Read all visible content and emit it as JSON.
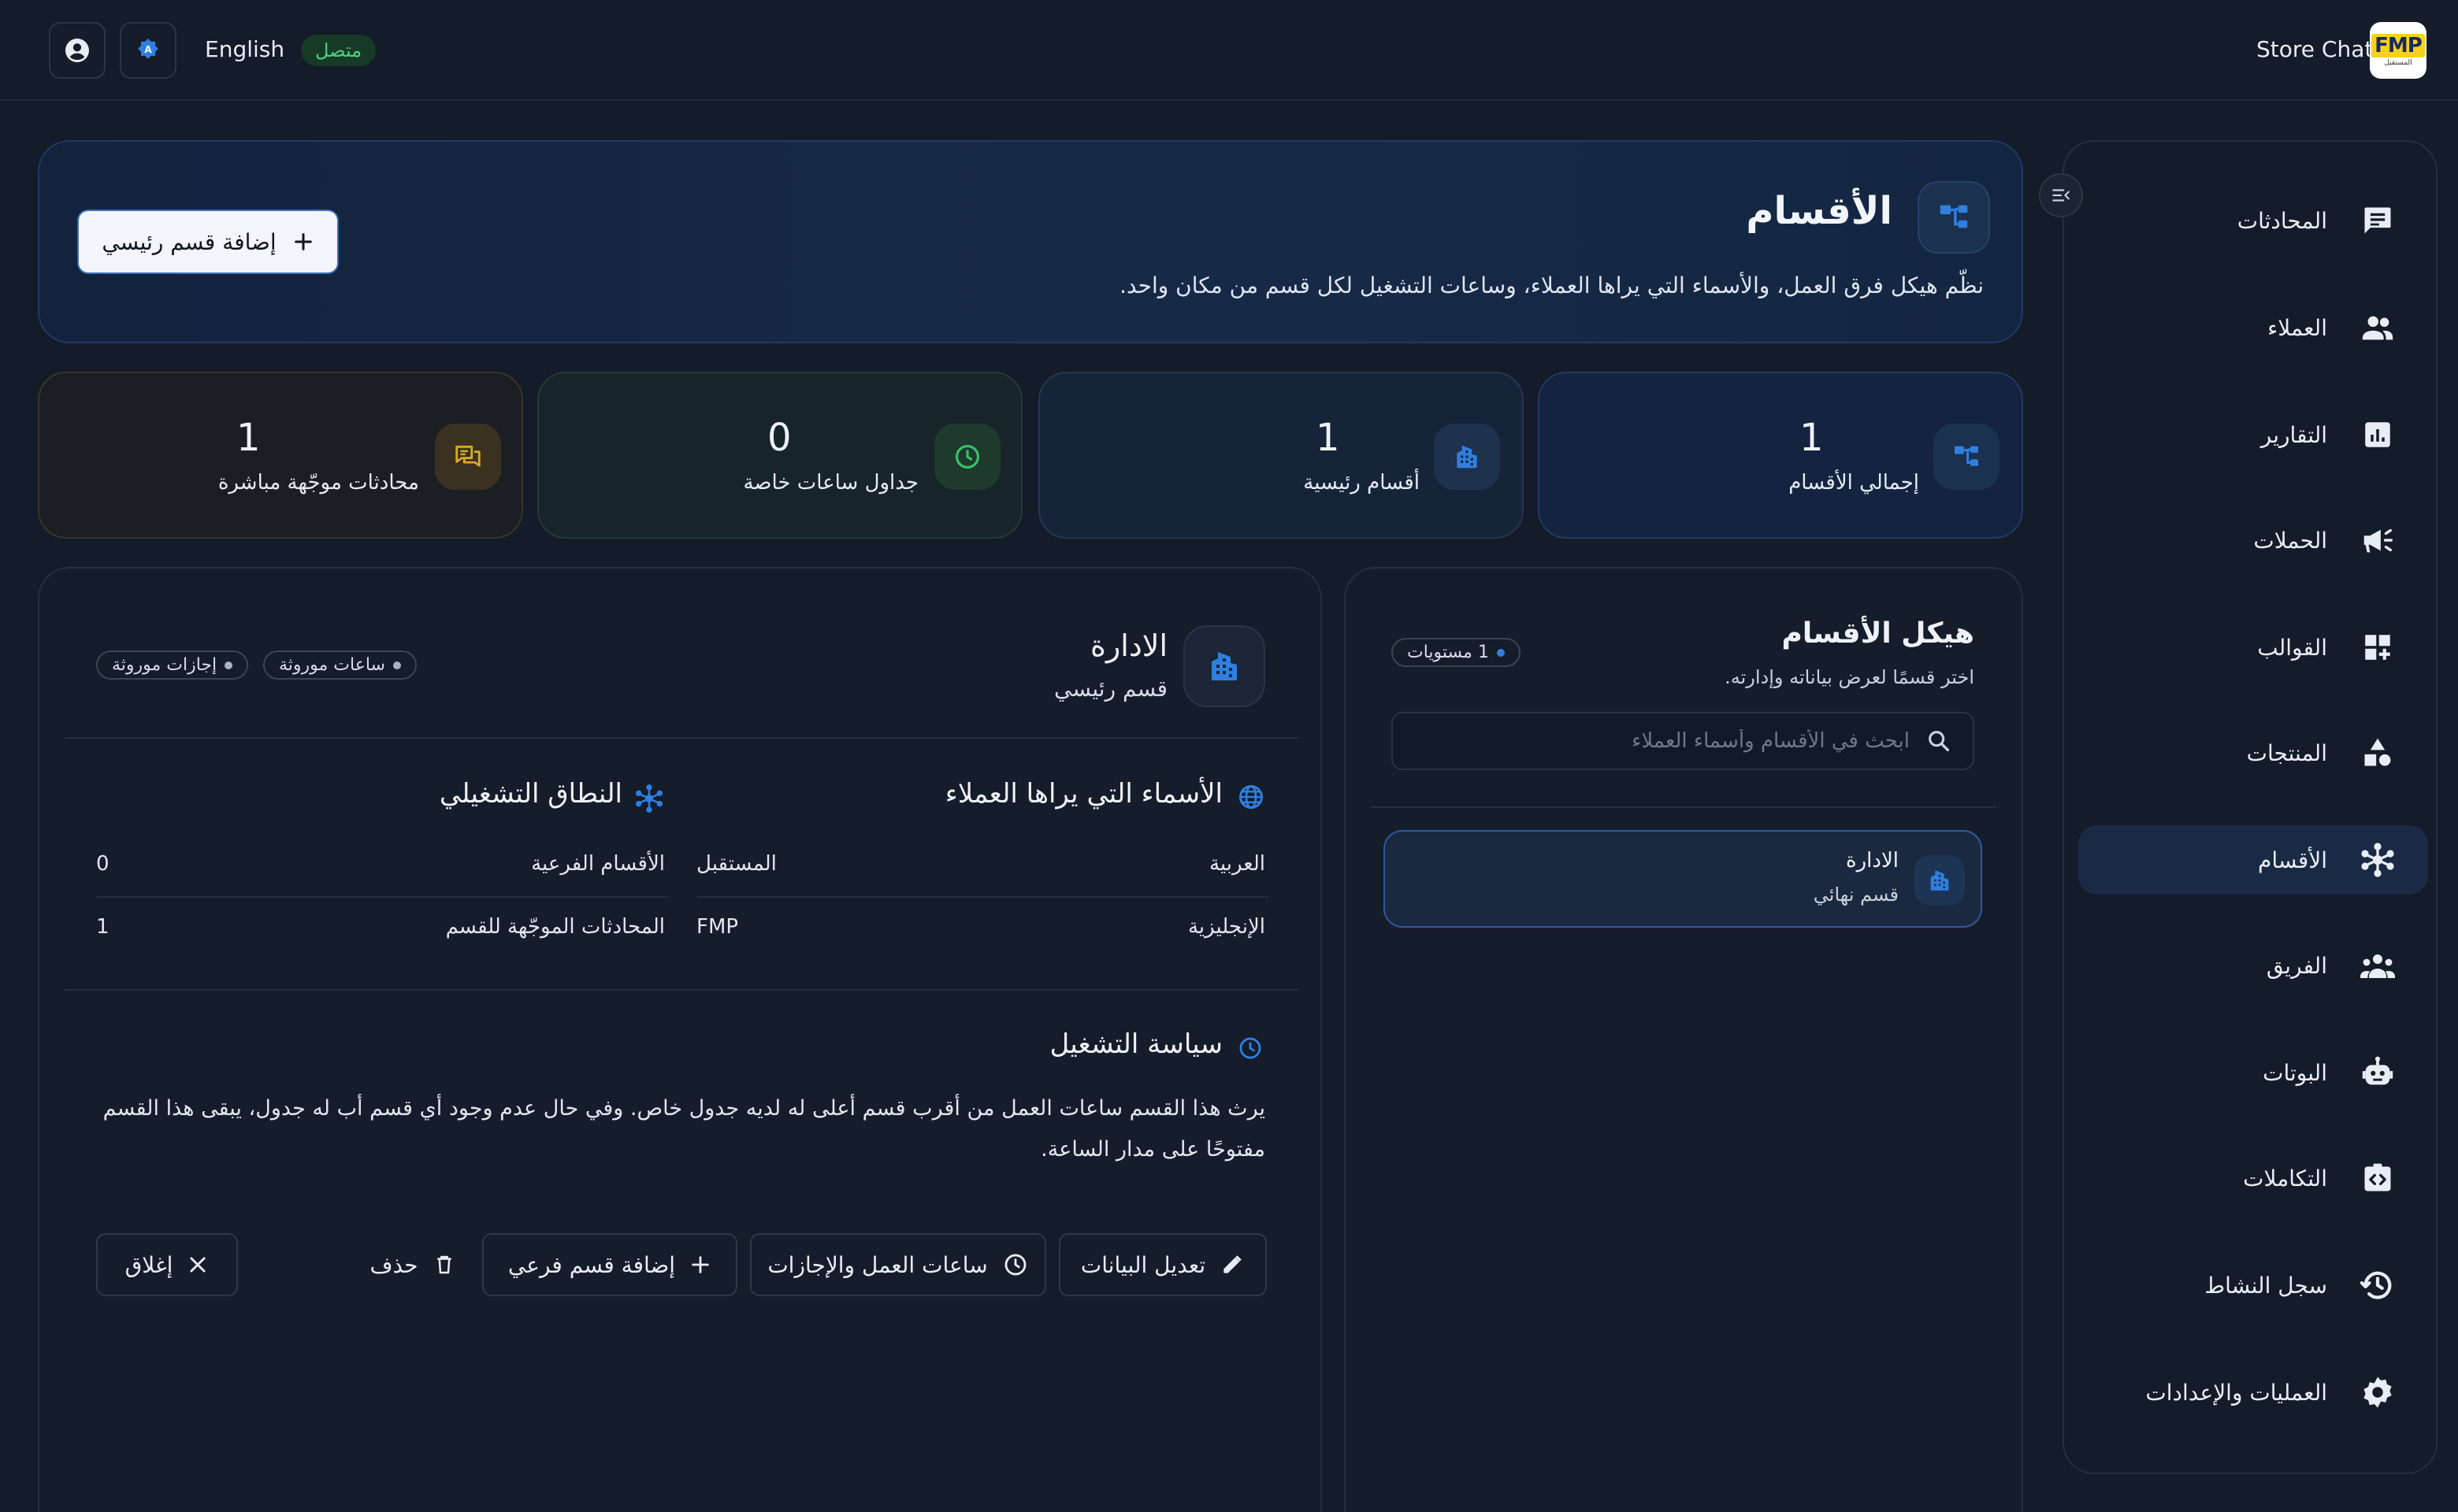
{
  "topbar": {
    "language": "English",
    "status": "متصل",
    "brand_name": "Store Chat",
    "logo_text": "FMP",
    "logo_subtext": "المستقبل"
  },
  "sidebar": {
    "items": [
      {
        "label": "المحادثات",
        "icon": "chat-icon",
        "active": false
      },
      {
        "label": "العملاء",
        "icon": "people-icon",
        "active": false
      },
      {
        "label": "التقارير",
        "icon": "report-icon",
        "active": false
      },
      {
        "label": "الحملات",
        "icon": "megaphone-icon",
        "active": false
      },
      {
        "label": "القوالب",
        "icon": "templates-icon",
        "active": false
      },
      {
        "label": "المنتجات",
        "icon": "products-icon",
        "active": false
      },
      {
        "label": "الأقسام",
        "icon": "departments-icon",
        "active": true
      },
      {
        "label": "الفريق",
        "icon": "team-icon",
        "active": false
      },
      {
        "label": "البوتات",
        "icon": "bot-icon",
        "active": false
      },
      {
        "label": "التكاملات",
        "icon": "integrations-icon",
        "active": false
      },
      {
        "label": "سجل النشاط",
        "icon": "history-icon",
        "active": false
      },
      {
        "label": "العمليات والإعدادات",
        "icon": "gear-icon",
        "active": false
      }
    ]
  },
  "header": {
    "title": "الأقسام",
    "subtitle": "نظّم هيكل فرق العمل، والأسماء التي يراها العملاء، وساعات التشغيل لكل قسم من مكان واحد.",
    "add_button": "إضافة قسم رئيسي"
  },
  "stats": [
    {
      "label": "إجمالي الأقسام",
      "value": "1",
      "icon": "tree-icon"
    },
    {
      "label": "أقسام رئيسية",
      "value": "1",
      "icon": "building-icon"
    },
    {
      "label": "جداول ساعات خاصة",
      "value": "0",
      "icon": "clock-icon"
    },
    {
      "label": "محادثات موجّهة مباشرة",
      "value": "1",
      "icon": "forum-icon"
    }
  ],
  "tree_panel": {
    "title": "هيكل الأقسام",
    "subtitle": "اختر قسمًا لعرض بياناته وإدارته.",
    "levels_badge": "1 مستويات",
    "search_placeholder": "ابحث في الأقسام وأسماء العملاء",
    "nodes": [
      {
        "name": "الادارة",
        "type": "قسم نهائي"
      }
    ]
  },
  "detail": {
    "name": "الادارة",
    "type": "قسم رئيسي",
    "chips": [
      "ساعات موروثة",
      "إجازات موروثة"
    ],
    "names_section": {
      "title": "الأسماء التي يراها العملاء",
      "rows": [
        {
          "key": "العربية",
          "value": "المستقبل"
        },
        {
          "key": "الإنجليزية",
          "value": "FMP"
        }
      ]
    },
    "scope_section": {
      "title": "النطاق التشغيلي",
      "rows": [
        {
          "key": "الأقسام الفرعية",
          "value": "0"
        },
        {
          "key": "المحادثات الموجّهة للقسم",
          "value": "1"
        }
      ]
    },
    "policy": {
      "title": "سياسة التشغيل",
      "text": "يرث هذا القسم ساعات العمل من أقرب قسم أعلى له لديه جدول خاص. وفي حال عدم وجود أي قسم أب له جدول، يبقى هذا القسم مفتوحًا على مدار الساعة."
    },
    "actions": {
      "edit": "تعديل البيانات",
      "hours": "ساعات العمل والإجازات",
      "add_sub": "إضافة قسم فرعي",
      "delete": "حذف",
      "close": "إغلاق"
    }
  },
  "colors": {
    "accent": "#2f7fe0",
    "online": "#4cd07f",
    "stat_green": "#3bbf6a",
    "stat_yellow": "#d9a92a"
  }
}
